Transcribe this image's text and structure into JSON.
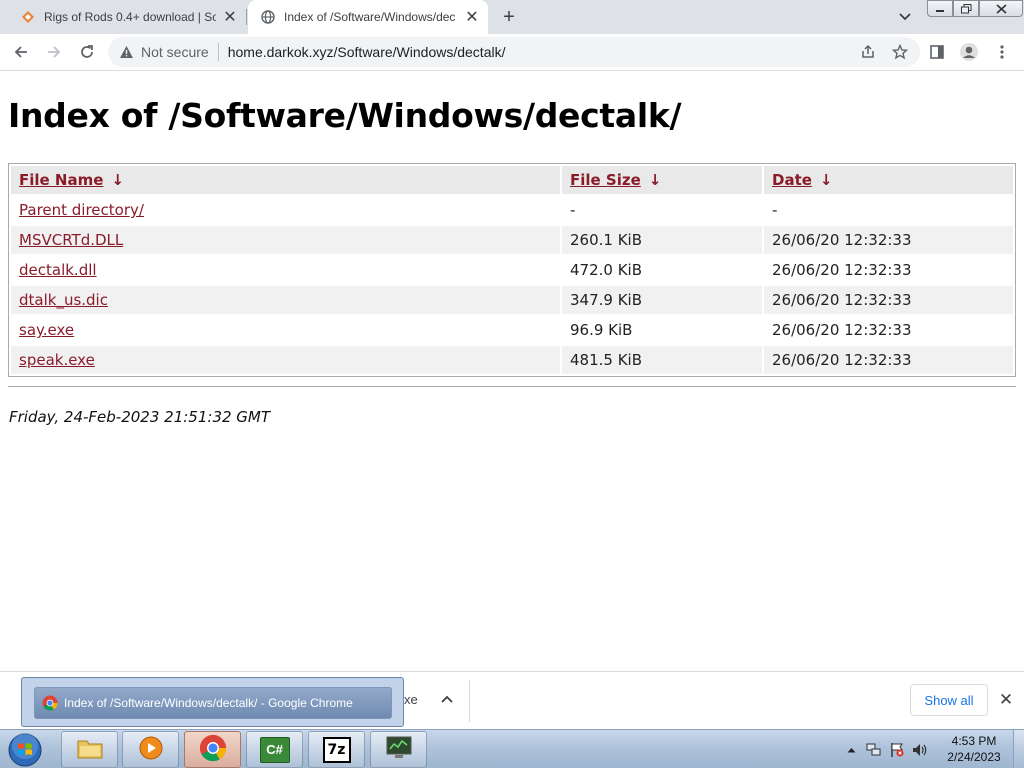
{
  "browser": {
    "tabs": [
      {
        "title": "Rigs of Rods 0.4+ download | So",
        "favicon": "diamond-favicon",
        "active": false
      },
      {
        "title": "Index of /Software/Windows/dec",
        "favicon": "globe-favicon",
        "active": true
      }
    ],
    "new_tab_label": "+",
    "address": {
      "security_label": "Not secure",
      "url": "home.darkok.xyz/Software/Windows/dectalk/"
    }
  },
  "page": {
    "heading": "Index of /Software/Windows/dectalk/",
    "columns": [
      {
        "label": "File Name",
        "arrow": "↓"
      },
      {
        "label": "File Size",
        "arrow": "↓"
      },
      {
        "label": "Date",
        "arrow": "↓"
      }
    ],
    "rows": [
      {
        "name": "Parent directory/",
        "size": "-",
        "date": "-"
      },
      {
        "name": "MSVCRTd.DLL",
        "size": "260.1 KiB",
        "date": "26/06/20 12:32:33"
      },
      {
        "name": "dectalk.dll",
        "size": "472.0 KiB",
        "date": "26/06/20 12:32:33"
      },
      {
        "name": "dtalk_us.dic",
        "size": "347.9 KiB",
        "date": "26/06/20 12:32:33"
      },
      {
        "name": "say.exe",
        "size": "96.9 KiB",
        "date": "26/06/20 12:32:33"
      },
      {
        "name": "speak.exe",
        "size": "481.5 KiB",
        "date": "26/06/20 12:32:33"
      }
    ],
    "footer_date": "Friday, 24-Feb-2023 21:51:32 GMT"
  },
  "download_shelf": {
    "item_suffix": "xe",
    "show_all_label": "Show all"
  },
  "taskbar": {
    "thumbnail_title": "Index of /Software/Windows/dectalk/ - Google Chrome",
    "clock_time": "4:53 PM",
    "clock_date": "2/24/2023",
    "app_7z_label": "7z",
    "app_cs_label": "C#"
  },
  "colors": {
    "link": "#8a1c2a",
    "header_bg": "#e9e9e9",
    "alt_row_bg": "#f1f1f1",
    "show_all_text": "#1a73e8"
  }
}
